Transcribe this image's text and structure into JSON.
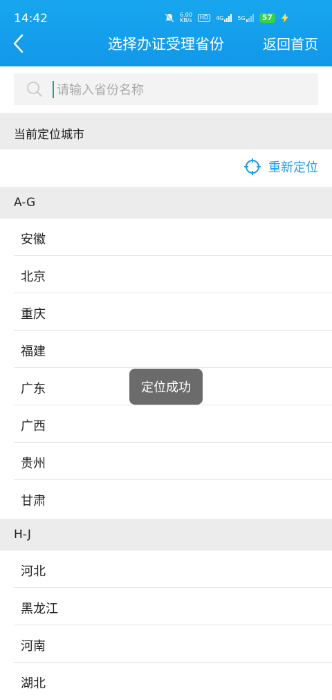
{
  "status_bar": {
    "time": "14:42",
    "speed_value": "6.00",
    "speed_unit": "KB/s",
    "hd_label": "HD",
    "network_4g": "4G",
    "network_5g": "5G",
    "battery": "57"
  },
  "header": {
    "title": "选择办证受理省份",
    "home_link": "返回首页"
  },
  "search": {
    "placeholder": "请输入省份名称",
    "value": ""
  },
  "location": {
    "section_label": "当前定位城市",
    "relocate_label": "重新定位"
  },
  "groups": [
    {
      "label": "A-G",
      "items": [
        "安徽",
        "北京",
        "重庆",
        "福建",
        "广东",
        "广西",
        "贵州",
        "甘肃"
      ]
    },
    {
      "label": "H-J",
      "items": [
        "河北",
        "黑龙江",
        "河南",
        "湖北"
      ]
    }
  ],
  "toast": {
    "text": "定位成功"
  },
  "colors": {
    "header_bg": "#1298ea",
    "accent": "#1a9af0",
    "section_bg": "#ececec",
    "toast_bg": "#6b6b6b"
  }
}
